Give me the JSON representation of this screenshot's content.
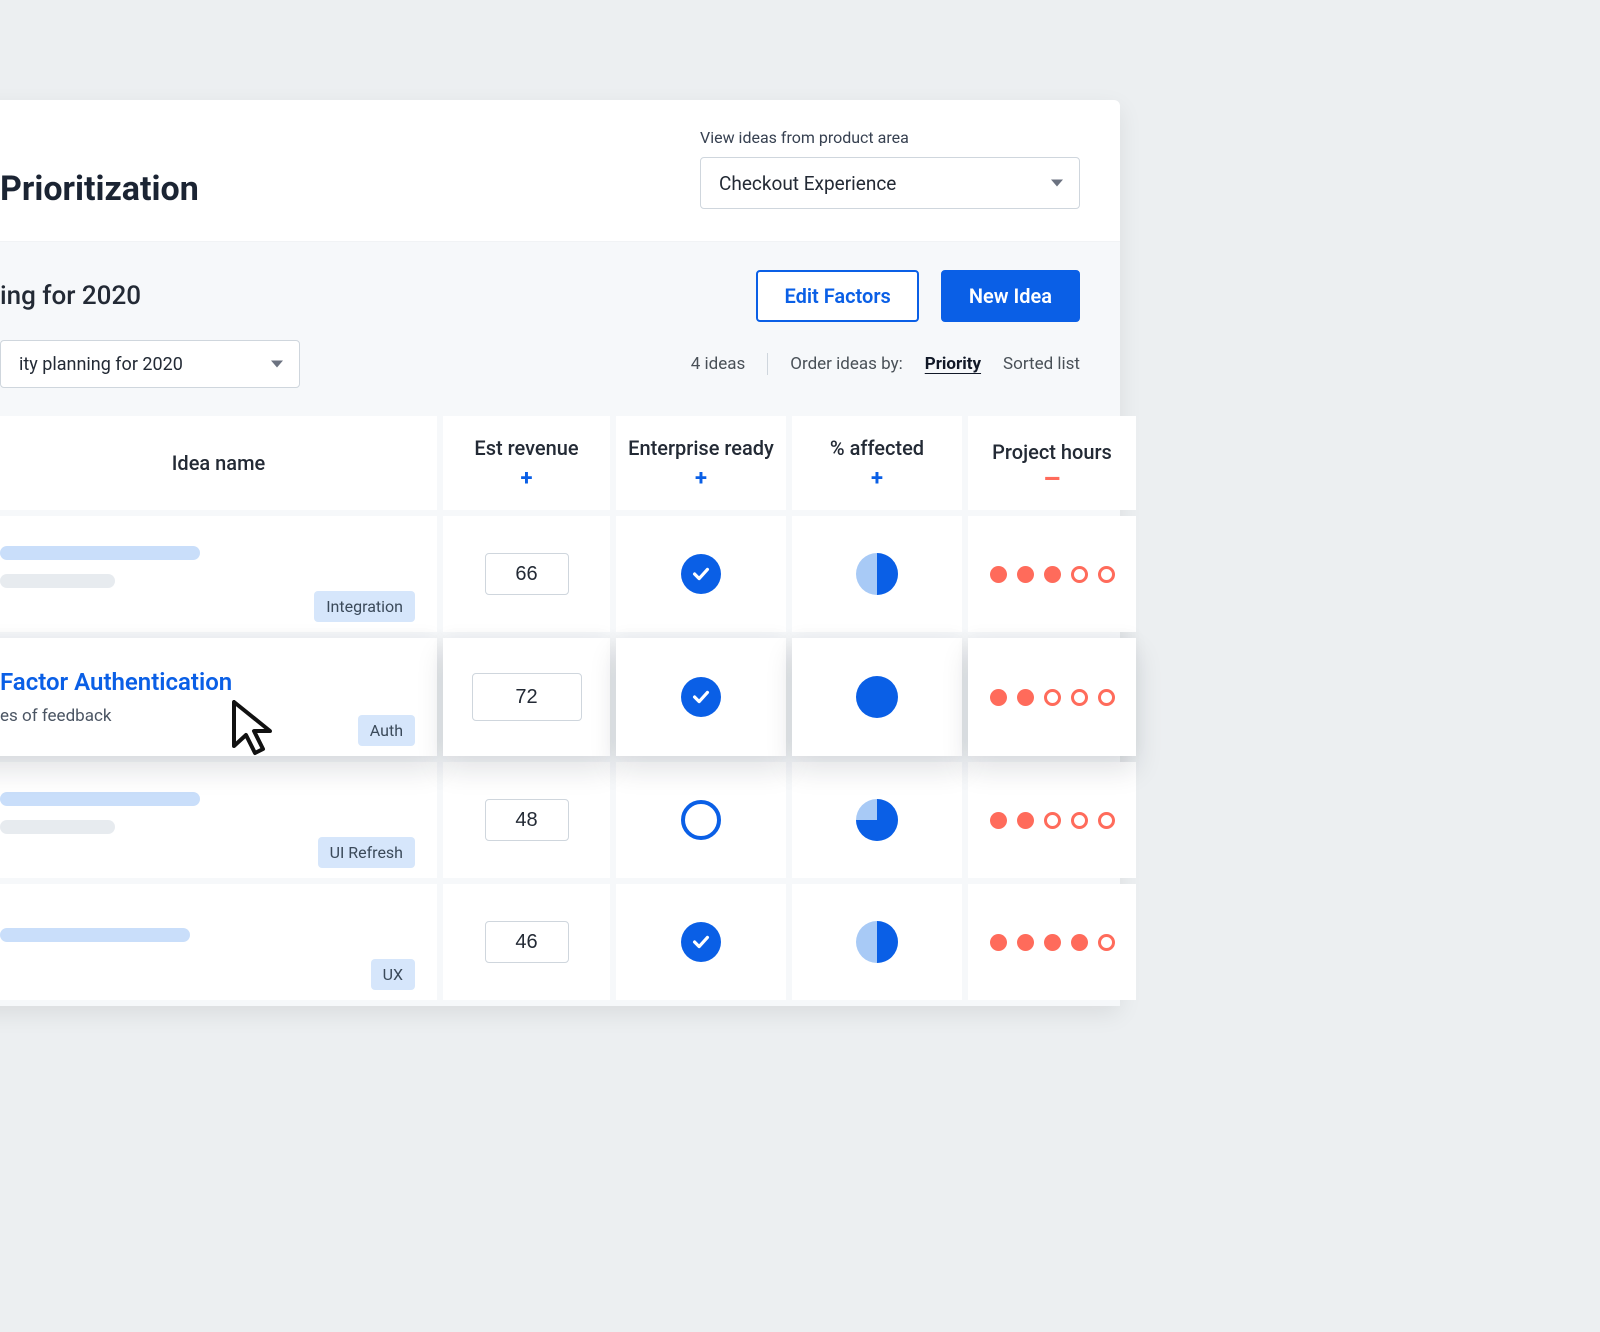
{
  "header": {
    "title": "Prioritization",
    "area_picker_label": "View ideas from product area",
    "area_picker_value": "Checkout Experience"
  },
  "subheader": {
    "priority_title": "ing for 2020",
    "plan_select_value": "ity planning for 2020",
    "edit_factors_label": "Edit Factors",
    "new_idea_label": "New Idea",
    "idea_count_label": "4 ideas",
    "order_label": "Order ideas by:",
    "order_active": "Priority",
    "order_alt": "Sorted list"
  },
  "columns": {
    "idea_name": "Idea name",
    "est_revenue": "Est revenue",
    "enterprise_ready": "Enterprise ready",
    "pct_affected": "% affected",
    "project_hours": "Project hours"
  },
  "rows": [
    {
      "tag": "Integration",
      "bar1_w": 200,
      "bar2_w": 115,
      "est_revenue": "66",
      "enterprise_ready": true,
      "pct_affected": 50,
      "project_hours": 3,
      "title_text": "",
      "sub_text": "",
      "raised": false
    },
    {
      "tag": "Auth",
      "title_text": "Factor Authentication",
      "sub_text": "es of feedback",
      "est_revenue": "72",
      "enterprise_ready": true,
      "pct_affected": 100,
      "project_hours": 2,
      "raised": true
    },
    {
      "tag": "UI Refresh",
      "bar1_w": 200,
      "bar2_w": 115,
      "est_revenue": "48",
      "enterprise_ready": false,
      "pct_affected": 75,
      "project_hours": 2,
      "title_text": "",
      "sub_text": "",
      "raised": false
    },
    {
      "tag": "UX",
      "bar1_w": 190,
      "bar2_w": 0,
      "est_revenue": "46",
      "enterprise_ready": true,
      "pct_affected": 50,
      "project_hours": 4,
      "title_text": "",
      "sub_text": "",
      "raised": false
    }
  ]
}
